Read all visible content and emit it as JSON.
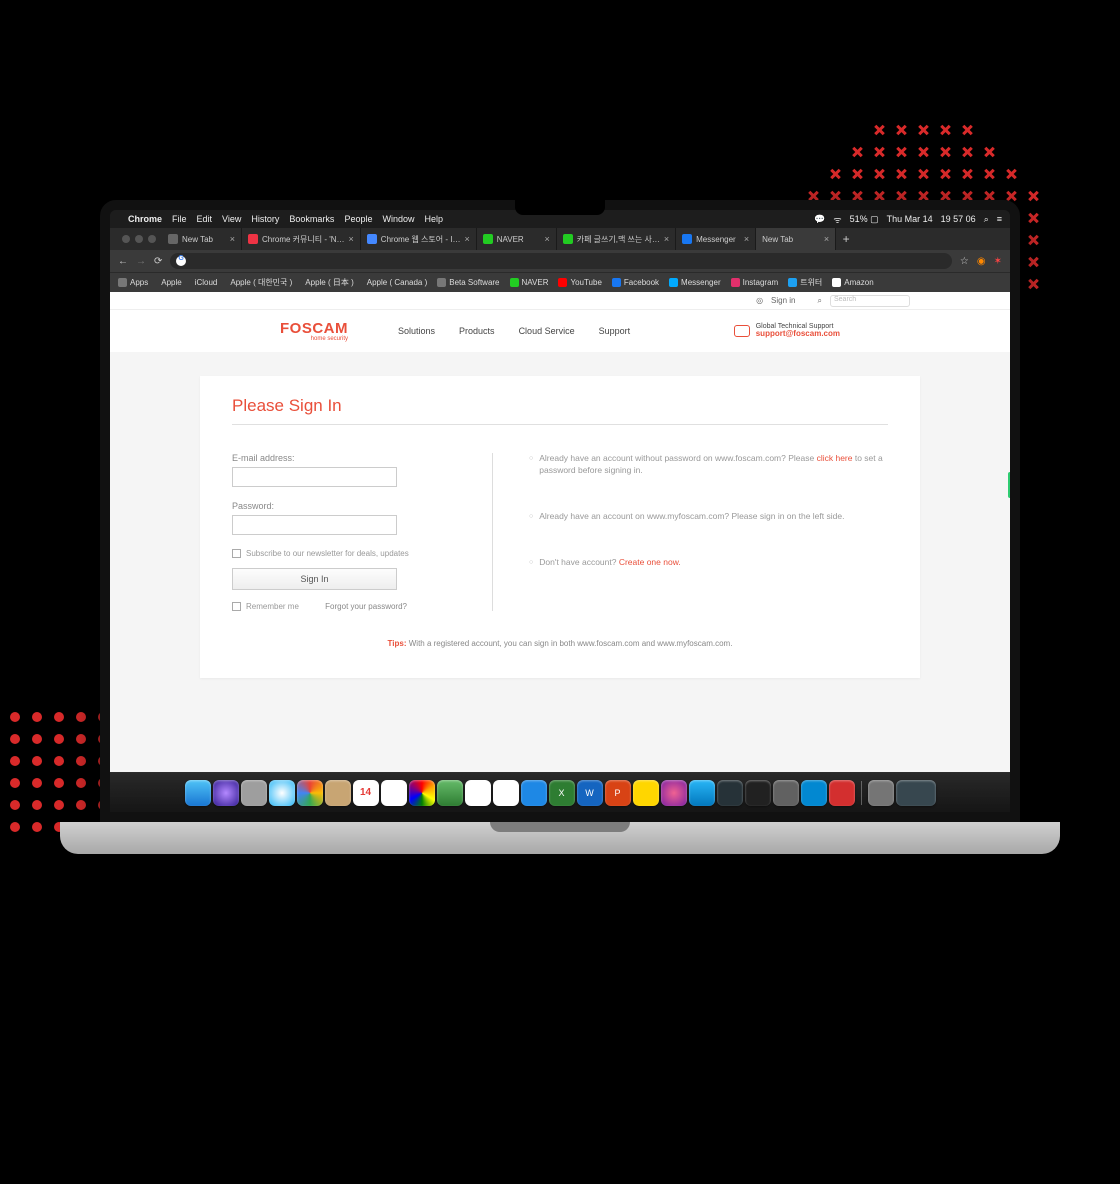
{
  "menubar": {
    "apple": "",
    "app": "Chrome",
    "items": [
      "File",
      "Edit",
      "View",
      "History",
      "Bookmarks",
      "People",
      "Window",
      "Help"
    ],
    "right": {
      "battery": "51%",
      "date": "Thu Mar 14",
      "time": "19 57 06"
    }
  },
  "tabs": [
    {
      "label": "New Tab",
      "active": false
    },
    {
      "label": "Chrome 커뮤니티 - 'N…",
      "active": false
    },
    {
      "label": "Chrome 웹 스토어 - I…",
      "active": false
    },
    {
      "label": "NAVER",
      "active": false
    },
    {
      "label": "카페 글쓰기,맥 쓰는 사…",
      "active": false
    },
    {
      "label": "Messenger",
      "active": false
    },
    {
      "label": "New Tab",
      "active": true
    }
  ],
  "bookmarks": [
    "Apps",
    "Apple",
    "iCloud",
    "Apple ( 대한민국 )",
    "Apple ( 日本 )",
    "Apple ( Canada )",
    "Beta Software",
    "NAVER",
    "YouTube",
    "Facebook",
    "Messenger",
    "Instagram",
    "트위터",
    "Amazon"
  ],
  "topbar": {
    "signin": "Sign in",
    "search_ph": "Search"
  },
  "brand": {
    "name": "FOSCAM",
    "tagline": "home security"
  },
  "nav": [
    "Solutions",
    "Products",
    "Cloud Service",
    "Support"
  ],
  "support": {
    "label": "Global Technical Support",
    "email": "support@foscam.com"
  },
  "page": {
    "title": "Please Sign In",
    "email_label": "E-mail address:",
    "password_label": "Password:",
    "newsletter": "Subscribe to our newsletter for deals, updates",
    "signin_btn": "Sign In",
    "remember": "Remember me",
    "forgot": "Forgot your password?",
    "info1a": "Already have an account without password on www.foscam.com? Please ",
    "info1_link": "click here",
    "info1b": " to set a password before signing in.",
    "info2": "Already have an account on www.myfoscam.com? Please sign in on the left side.",
    "info3a": "Don't have account? ",
    "info3_link": "Create one now.",
    "tips_label": "Tips:",
    "tips_text": " With a registered account, you can sign in both www.foscam.com and www.myfoscam.com."
  }
}
